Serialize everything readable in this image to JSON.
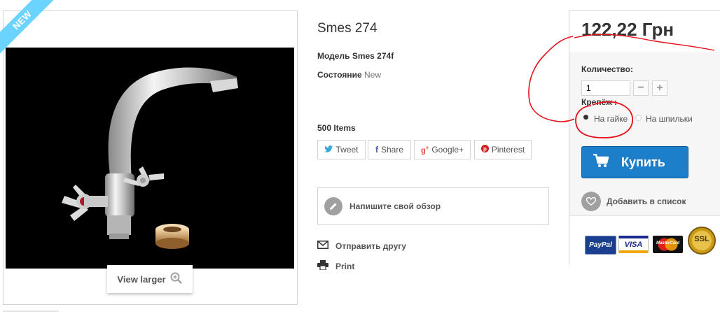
{
  "product": {
    "badge": "NEW",
    "title": "Smes 274",
    "model_label": "Модель",
    "model_value": "Smes 274f",
    "condition_label": "Состояние",
    "condition_value": "New",
    "stock": "500 Items",
    "view_larger": "View larger"
  },
  "share": {
    "tweet": "Tweet",
    "share": "Share",
    "google": "Google+",
    "pinterest": "Pinterest"
  },
  "actions": {
    "review": "Напишите свой обзор",
    "send_friend": "Отправить другу",
    "print": "Print"
  },
  "buy_box": {
    "price": "122,22 Грн",
    "quantity_label": "Количество:",
    "quantity_value": "1",
    "fixing_label": "Крепёж :",
    "options": [
      "На гайке",
      "На шпильки"
    ],
    "selected_option": "На гайке",
    "buy_label": "Купить",
    "wishlist_label": "Добавить в список"
  },
  "payment_logos": [
    "PayPal",
    "VISA",
    "MasterCard",
    "SSL"
  ],
  "colors": {
    "accent": "#1d7fc9",
    "badge": "#6ad4ff",
    "annotation": "#e8101a"
  }
}
